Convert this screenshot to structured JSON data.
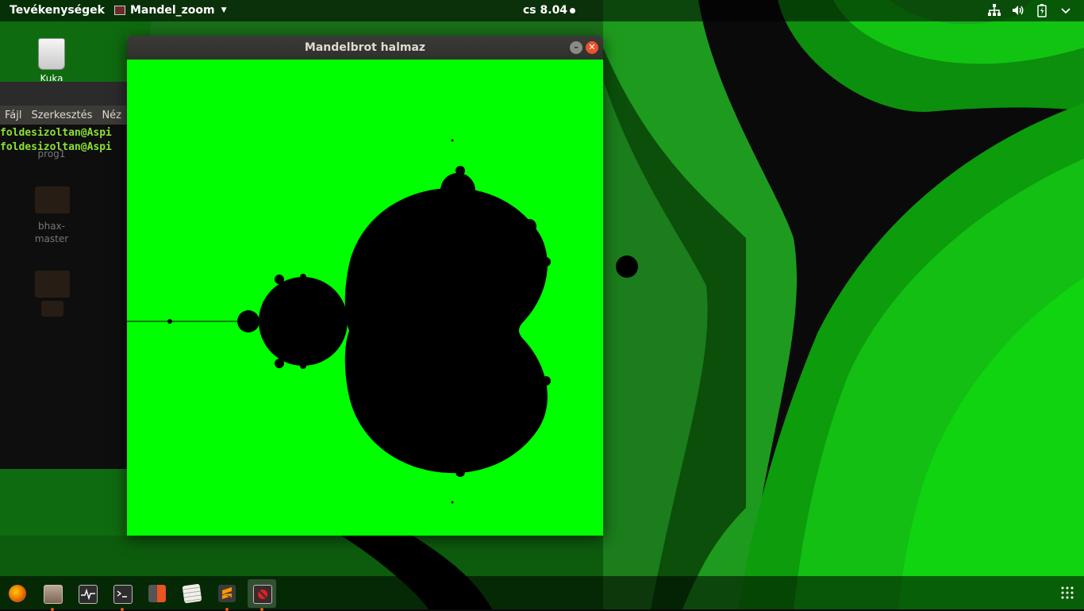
{
  "topbar": {
    "activities_label": "Tevékenységek",
    "app_menu_label": "Mandel_zoom",
    "clock": "cs  8.04",
    "tray_icons": [
      "network-icon",
      "volume-icon",
      "battery-icon",
      "system-menu-icon"
    ]
  },
  "desktop": {
    "trash_label": "Kuka",
    "folder1_label": "prog1",
    "folder2_label": "bhax-master"
  },
  "terminal": {
    "menu": [
      "Fájl",
      "Szerkesztés",
      "Néz"
    ],
    "lines": [
      "foldesizoltan@Aspi",
      "foldesizoltan@Aspi"
    ]
  },
  "mandel_window": {
    "title": "Mandelbrot halmaz",
    "background_color": "#00ff00",
    "set_color": "#000000"
  },
  "dock": {
    "items": [
      {
        "name": "firefox",
        "color": "#e66000"
      },
      {
        "name": "files",
        "color": "#9a7d6a"
      },
      {
        "name": "system-monitor",
        "color": "#2d2d2d"
      },
      {
        "name": "terminal",
        "color": "#2d2d2d"
      },
      {
        "name": "calculator",
        "color": "#e95420"
      },
      {
        "name": "text-editor",
        "color": "#f0f0e6"
      },
      {
        "name": "sublime-text",
        "color": "#ff9800"
      },
      {
        "name": "mandel-zoom",
        "color": "#6b2a2a"
      }
    ]
  }
}
